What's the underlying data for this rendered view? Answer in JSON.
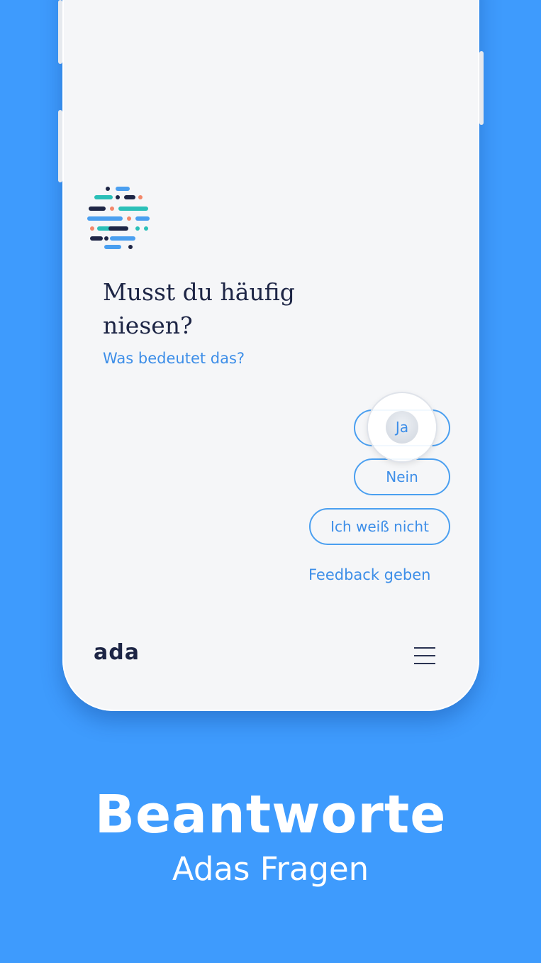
{
  "colors": {
    "background": "#3e9bfd",
    "screen": "#f5f6f8",
    "accent": "#3d8ee8",
    "text_dark": "#1d2545"
  },
  "question": {
    "line1": "Musst du häufig",
    "line2": "niesen?",
    "explain_link": "Was bedeutet das?"
  },
  "answers": {
    "yes": "Ja",
    "no": "Nein",
    "dont_know": "Ich weiß nicht"
  },
  "feedback_link": "Feedback geben",
  "footer": {
    "brand": "ada",
    "menu_icon": "hamburger-menu-icon"
  },
  "logo_icon": "ada-dot-sphere-logo",
  "promo": {
    "headline": "Beantworte",
    "subline": "Adas Fragen"
  }
}
